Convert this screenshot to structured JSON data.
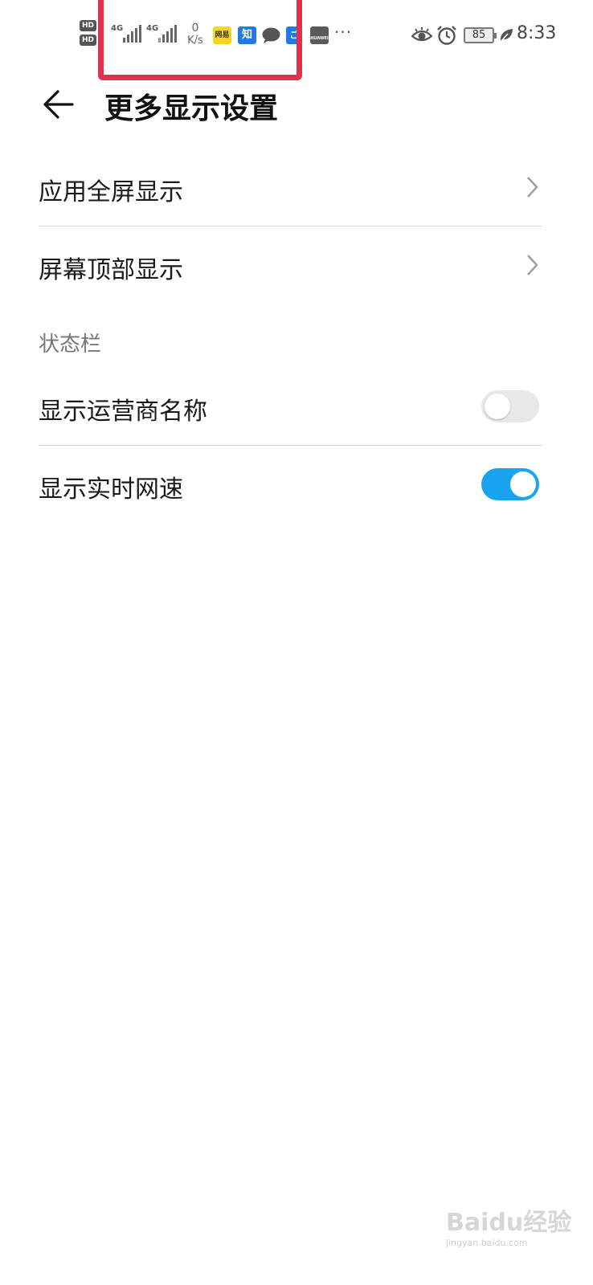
{
  "status_bar": {
    "hd_badges": [
      "HD",
      "HD"
    ],
    "sim1_label": "4G",
    "sim2_label": "4G",
    "net_speed_value": "0",
    "net_speed_unit": "K/s",
    "apps": {
      "netease": "网易",
      "zhihu": "知",
      "blue_app": "ご",
      "huawei": "HUAWEI"
    },
    "more": "···",
    "battery": "85",
    "time": "8:33",
    "highlight_color": "#e2314b"
  },
  "header": {
    "title": "更多显示设置"
  },
  "list": {
    "fullscreen": "应用全屏显示",
    "top_display": "屏幕顶部显示",
    "section_status_bar": "状态栏",
    "show_carrier": "显示运营商名称",
    "show_carrier_enabled": false,
    "show_speed": "显示实时网速",
    "show_speed_enabled": true
  },
  "watermark": {
    "brand": "Baidu经验",
    "url": "jingyan.baidu.com"
  },
  "colors": {
    "toggle_on": "#1aa3ef",
    "toggle_off": "#e8e8e8"
  }
}
